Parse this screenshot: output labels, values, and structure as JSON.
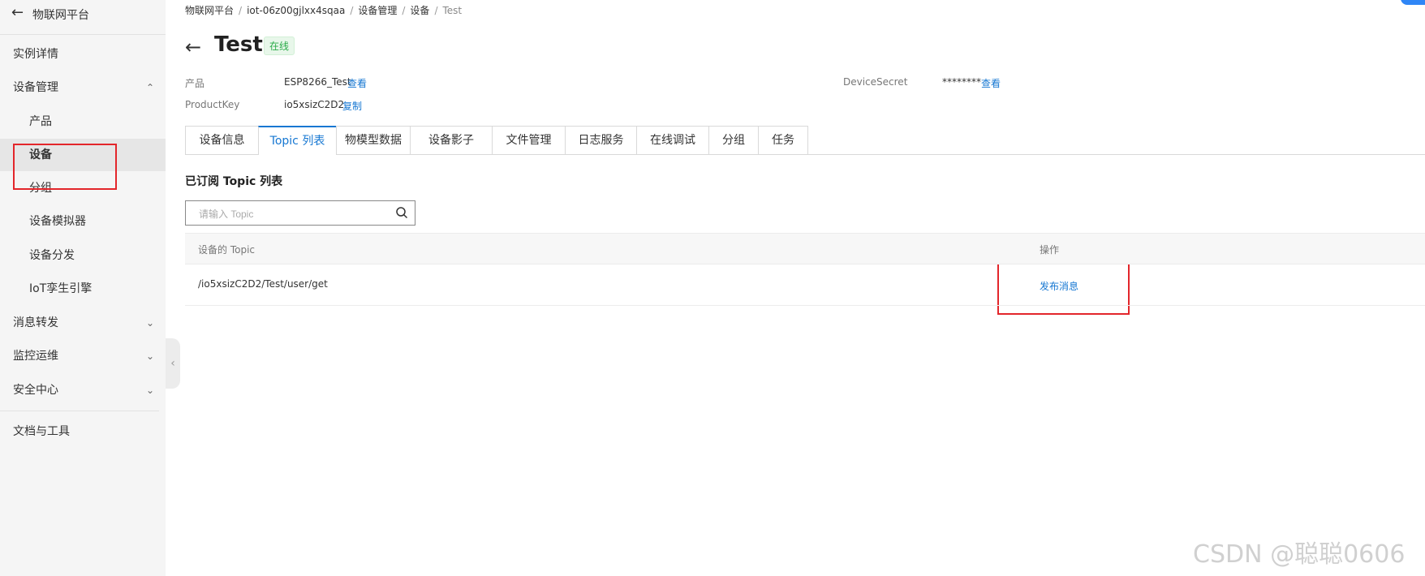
{
  "sidebar": {
    "back_icon": "arrow-left-icon",
    "title": "物联网平台",
    "items": [
      {
        "label": "实例详情"
      },
      {
        "label": "设备管理",
        "chevron": "chevron-up-icon"
      },
      {
        "label": "产品"
      },
      {
        "label": "设备"
      },
      {
        "label": "分组"
      },
      {
        "label": "设备模拟器"
      },
      {
        "label": "设备分发"
      },
      {
        "label": "IoT孪生引擎"
      },
      {
        "label": "消息转发",
        "chevron": "chevron-down-icon"
      },
      {
        "label": "监控运维",
        "chevron": "chevron-down-icon"
      },
      {
        "label": "安全中心",
        "chevron": "chevron-down-icon"
      },
      {
        "label": "文档与工具"
      }
    ]
  },
  "breadcrumb": [
    "物联网平台",
    "iot-06z00gjlxx4sqaa",
    "设备管理",
    "设备",
    "Test"
  ],
  "page": {
    "title": "Test",
    "status": "在线"
  },
  "info": {
    "product_label": "产品",
    "product_value": "ESP8266_Test",
    "product_link": "查看",
    "productkey_label": "ProductKey",
    "productkey_value": "io5xsizC2D2",
    "productkey_link": "复制",
    "secret_label": "DeviceSecret",
    "secret_value": "********",
    "secret_link": "查看"
  },
  "tabs": [
    {
      "label": "设备信息"
    },
    {
      "label": "Topic 列表",
      "active": true
    },
    {
      "label": "物模型数据"
    },
    {
      "label": "设备影子"
    },
    {
      "label": "文件管理"
    },
    {
      "label": "日志服务"
    },
    {
      "label": "在线调试"
    },
    {
      "label": "分组"
    },
    {
      "label": "任务"
    }
  ],
  "section_title": "已订阅 Topic 列表",
  "search": {
    "placeholder": "请输入 Topic",
    "value": ""
  },
  "table": {
    "columns": [
      "设备的 Topic",
      "操作"
    ],
    "rows": [
      {
        "topic": "/io5xsizC2D2/Test/user/get",
        "action": "发布消息"
      }
    ]
  },
  "watermark": "CSDN @聪聪0606",
  "colors": {
    "accent": "#1677d2",
    "online": "#2bab49",
    "annotation": "#e3262b",
    "sidebar_bg": "#f5f5f5"
  }
}
